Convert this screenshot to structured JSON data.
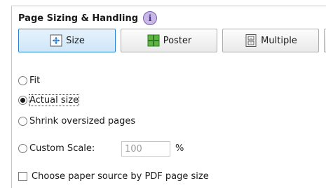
{
  "section": {
    "title": "Page Sizing & Handling",
    "info_icon": "info-icon"
  },
  "mode_buttons": [
    {
      "label": "Size",
      "icon": "page-size-icon",
      "selected": true
    },
    {
      "label": "Poster",
      "icon": "poster-icon",
      "selected": false
    },
    {
      "label": "Multiple",
      "icon": "multiple-pages-icon",
      "selected": false
    }
  ],
  "options": {
    "fit": "Fit",
    "actual_size": "Actual size",
    "shrink": "Shrink oversized pages",
    "custom_scale": "Custom Scale:",
    "selected": "Actual size"
  },
  "custom_scale": {
    "value": "100",
    "unit": "%"
  },
  "paper_source": {
    "label": "Choose paper source by PDF page size",
    "checked": false
  },
  "colors": {
    "accent_border": "#2b81cf",
    "selected_fill": "#d7eaf9",
    "info_icon": "#c9b7e6"
  }
}
